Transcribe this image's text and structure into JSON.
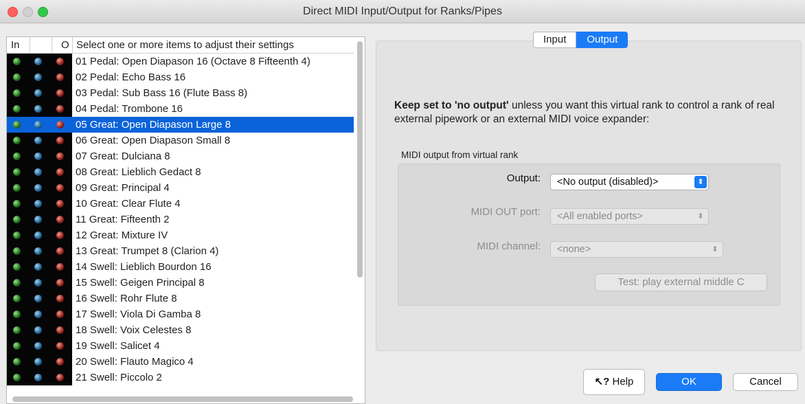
{
  "window": {
    "title": "Direct MIDI Input/Output for Ranks/Pipes"
  },
  "list": {
    "header": {
      "col_in": "In",
      "col_o": "O",
      "col_desc": "Select one or more items to adjust their settings"
    },
    "selected_index": 4,
    "items": [
      "01 Pedal: Open Diapason 16 (Octave 8 Fifteenth 4)",
      "02 Pedal: Echo Bass 16",
      "03 Pedal: Sub Bass 16 (Flute Bass 8)",
      "04 Pedal: Trombone 16",
      "05 Great: Open Diapason Large 8",
      "06 Great: Open Diapason Small 8",
      "07 Great: Dulciana 8",
      "08 Great: Lieblich Gedact 8",
      "09 Great: Principal 4",
      "10 Great: Clear Flute 4",
      "11 Great: Fifteenth 2",
      "12 Great: Mixture IV",
      "13 Great: Trumpet 8 (Clarion 4)",
      "14 Swell: Lieblich Bourdon 16",
      "15 Swell: Geigen Principal 8",
      "16 Swell: Rohr Flute 8",
      "17 Swell: Viola Di Gamba 8",
      "18 Swell: Voix Celestes 8",
      "19 Swell: Salicet 4",
      "20 Swell: Flauto Magico 4",
      "21 Swell: Piccolo 2"
    ]
  },
  "tabs": {
    "input": "Input",
    "output": "Output",
    "active": "output"
  },
  "warning": {
    "prefix": "Keep set to '",
    "bold": "no output",
    "suffix": "' unless you want this virtual rank to control a rank of real external pipework or an external MIDI voice expander:"
  },
  "group": {
    "label": "MIDI output from virtual rank",
    "output_label": "Output:",
    "output_value": "<No output (disabled)>",
    "port_label": "MIDI OUT port:",
    "port_value": "<All enabled ports>",
    "channel_label": "MIDI channel:",
    "channel_value": "<none>",
    "test_button": "Test: play external middle C"
  },
  "footer": {
    "help": "Help",
    "ok": "OK",
    "cancel": "Cancel"
  },
  "colors": {
    "selection": "#0b63d9",
    "accent": "#1a7bf6"
  }
}
